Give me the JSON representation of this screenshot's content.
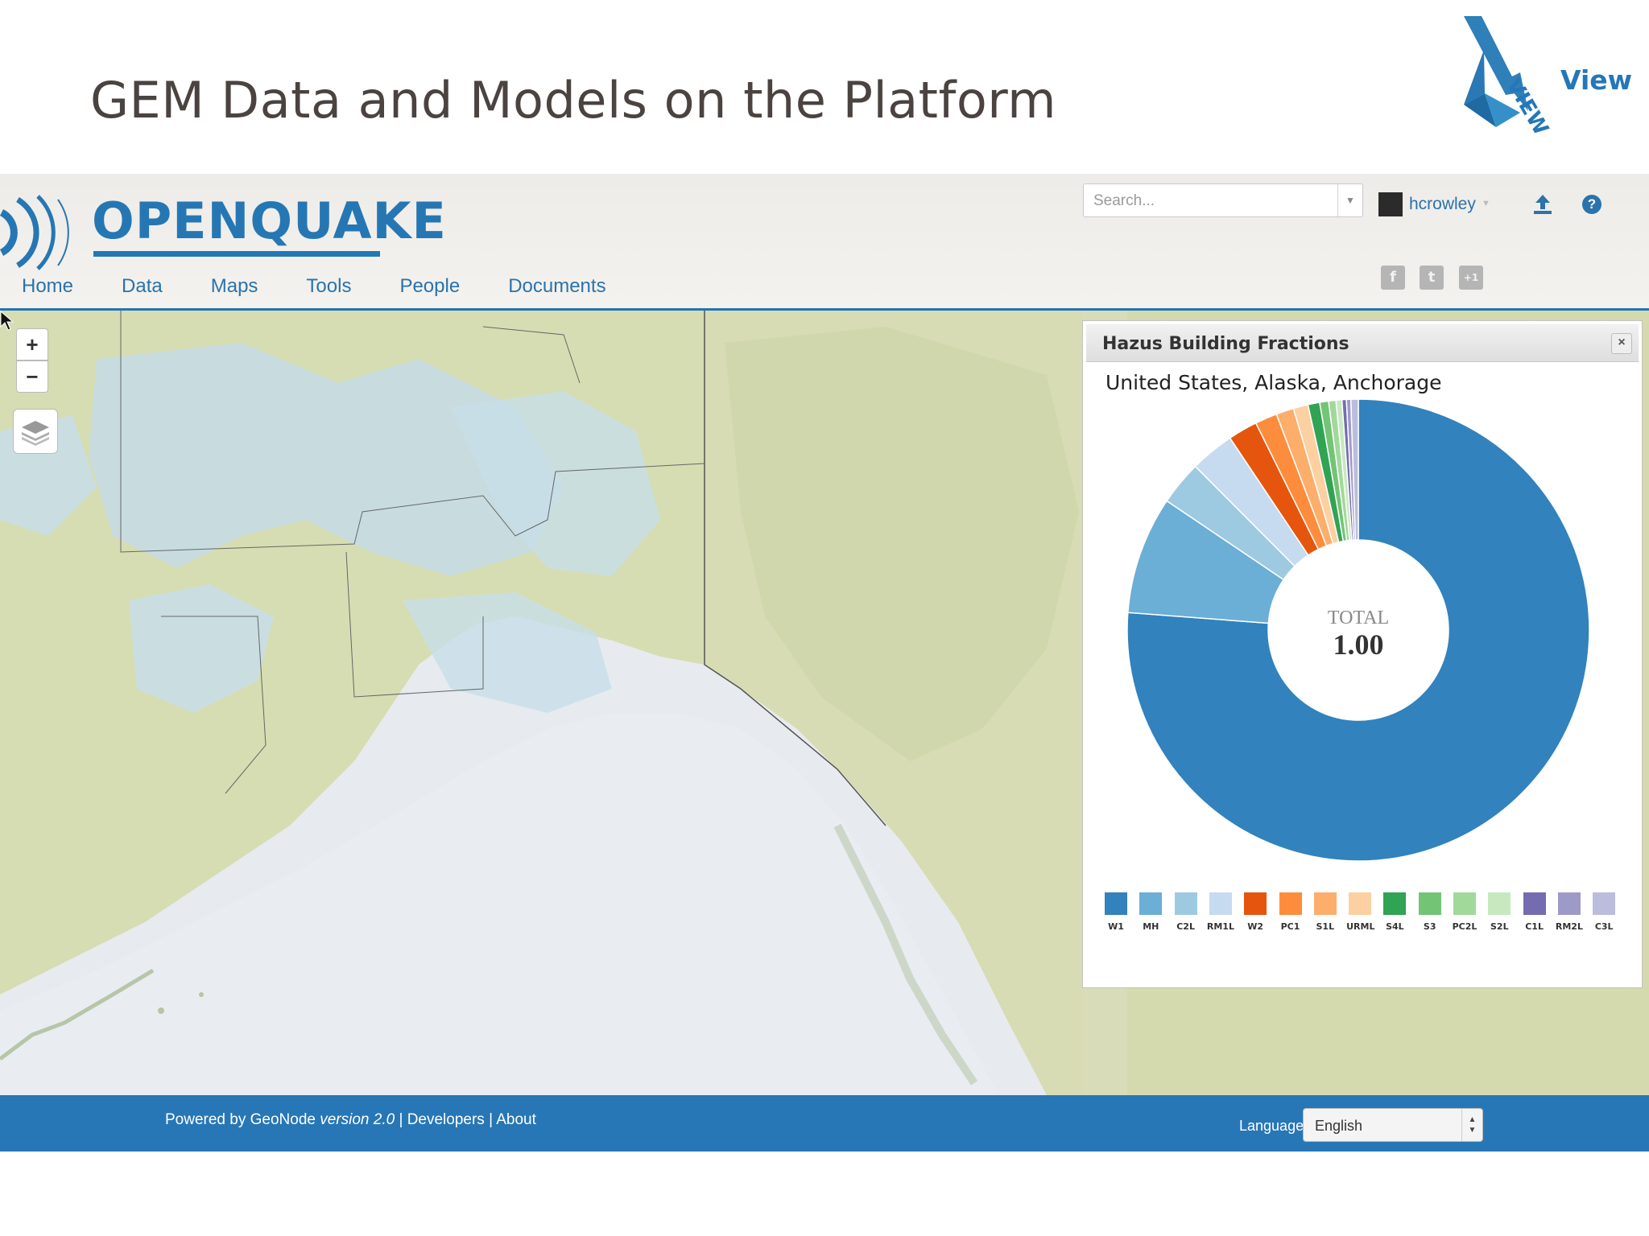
{
  "slide": {
    "title": "GEM Data and Models on the Platform",
    "logo_word": "View",
    "logo_mark_text": "VIEW"
  },
  "app": {
    "brand": "OPENQUAKE",
    "nav": [
      {
        "label": "Home"
      },
      {
        "label": "Data"
      },
      {
        "label": "Maps"
      },
      {
        "label": "Tools"
      },
      {
        "label": "People"
      },
      {
        "label": "Documents"
      }
    ],
    "search": {
      "placeholder": "Search...",
      "value": ""
    },
    "user": {
      "name": "hcrowley"
    },
    "icons": {
      "upload": "upload-icon",
      "help": "help-icon",
      "social": [
        "facebook-icon",
        "twitter-icon",
        "google-plus-icon"
      ]
    },
    "social_labels": {
      "facebook": "f",
      "twitter": "t",
      "gplus": "+1"
    },
    "help_label": "?",
    "map_controls": {
      "zoom_in": "+",
      "zoom_out": "−"
    }
  },
  "popup": {
    "title": "Hazus Building Fractions",
    "location": "United States, Alaska, Anchorage",
    "close_label": "×",
    "center_label": "TOTAL",
    "center_value": "1.00"
  },
  "chart_data": {
    "type": "pie",
    "donut": true,
    "categories": [
      "W1",
      "MH",
      "C2L",
      "RM1L",
      "W2",
      "PC1",
      "S1L",
      "URML",
      "S4L",
      "S3",
      "PC2L",
      "S2L",
      "C1L",
      "RM2L",
      "C3L"
    ],
    "values": [
      0.74,
      0.08,
      0.03,
      0.03,
      0.02,
      0.015,
      0.012,
      0.01,
      0.008,
      0.006,
      0.005,
      0.004,
      0.003,
      0.003,
      0.005
    ],
    "colors": [
      "#3182bd",
      "#6baed6",
      "#9ecae1",
      "#c6dbef",
      "#e6550d",
      "#fd8d3c",
      "#fdae6b",
      "#fdd0a2",
      "#31a354",
      "#74c476",
      "#a1d99b",
      "#c7e9c0",
      "#756bb1",
      "#9e9ac8",
      "#bcbddc"
    ],
    "legend_position": "bottom"
  },
  "footer": {
    "powered_prefix": "Powered by GeoNode ",
    "version": "version 2.0",
    "developers": "Developers",
    "about": "About",
    "separator": " | ",
    "language_label": "Language",
    "language_value": "English"
  }
}
